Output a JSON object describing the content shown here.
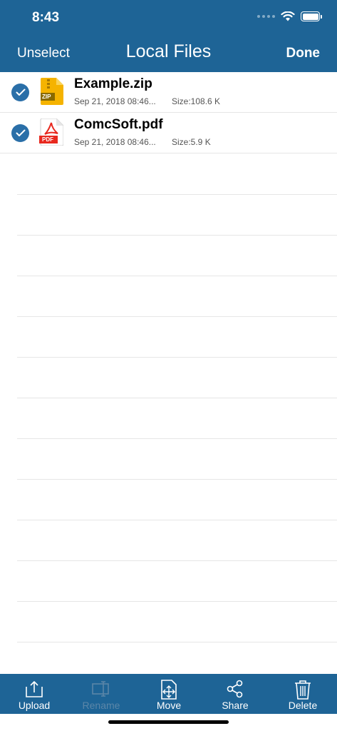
{
  "status": {
    "time": "8:43"
  },
  "nav": {
    "left": "Unselect",
    "title": "Local Files",
    "right": "Done"
  },
  "files": [
    {
      "name": "Example.zip",
      "date": "Sep 21, 2018 08:46...",
      "size": "Size:108.6 K",
      "icon": "zip-file-icon",
      "icon_label": "ZIP",
      "selected": true
    },
    {
      "name": "ComcSoft.pdf",
      "date": "Sep 21, 2018 08:46...",
      "size": "Size:5.9 K",
      "icon": "pdf-file-icon",
      "icon_label": "PDF",
      "selected": true
    }
  ],
  "toolbar": {
    "upload": "Upload",
    "rename": "Rename",
    "move": "Move",
    "share": "Share",
    "delete": "Delete"
  },
  "colors": {
    "header": "#1e6496",
    "check": "#2a6fa8",
    "zip": "#f5b300",
    "pdf": "#e8281e"
  }
}
